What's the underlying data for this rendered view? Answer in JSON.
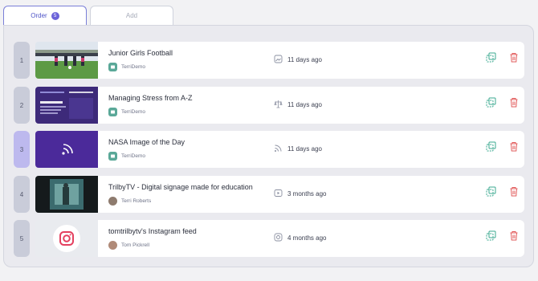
{
  "tabs": {
    "order_label": "Order",
    "order_count": "5",
    "add_label": "Add"
  },
  "items": [
    {
      "index": "1",
      "title": "Junior Girls Football",
      "author": "TerriDemo",
      "time": "11 days ago",
      "source_icon": "image-icon"
    },
    {
      "index": "2",
      "title": "Managing Stress from A-Z",
      "author": "TerriDemo",
      "time": "11 days ago",
      "source_icon": "scale-icon"
    },
    {
      "index": "3",
      "title": "NASA Image of the Day",
      "author": "TerriDemo",
      "time": "11 days ago",
      "source_icon": "rss-icon"
    },
    {
      "index": "4",
      "title": "TrilbyTV - Digital signage made for education",
      "author": "Terri Roberts",
      "time": "3 months ago",
      "source_icon": "video-icon"
    },
    {
      "index": "5",
      "title": "tomtrilbytv's Instagram feed",
      "author": "Tom Pickrell",
      "time": "4 months ago",
      "source_icon": "instagram-icon"
    }
  ],
  "colors": {
    "accent": "#6b63d9",
    "copy": "#3aa88f",
    "delete": "#e25b5b"
  }
}
